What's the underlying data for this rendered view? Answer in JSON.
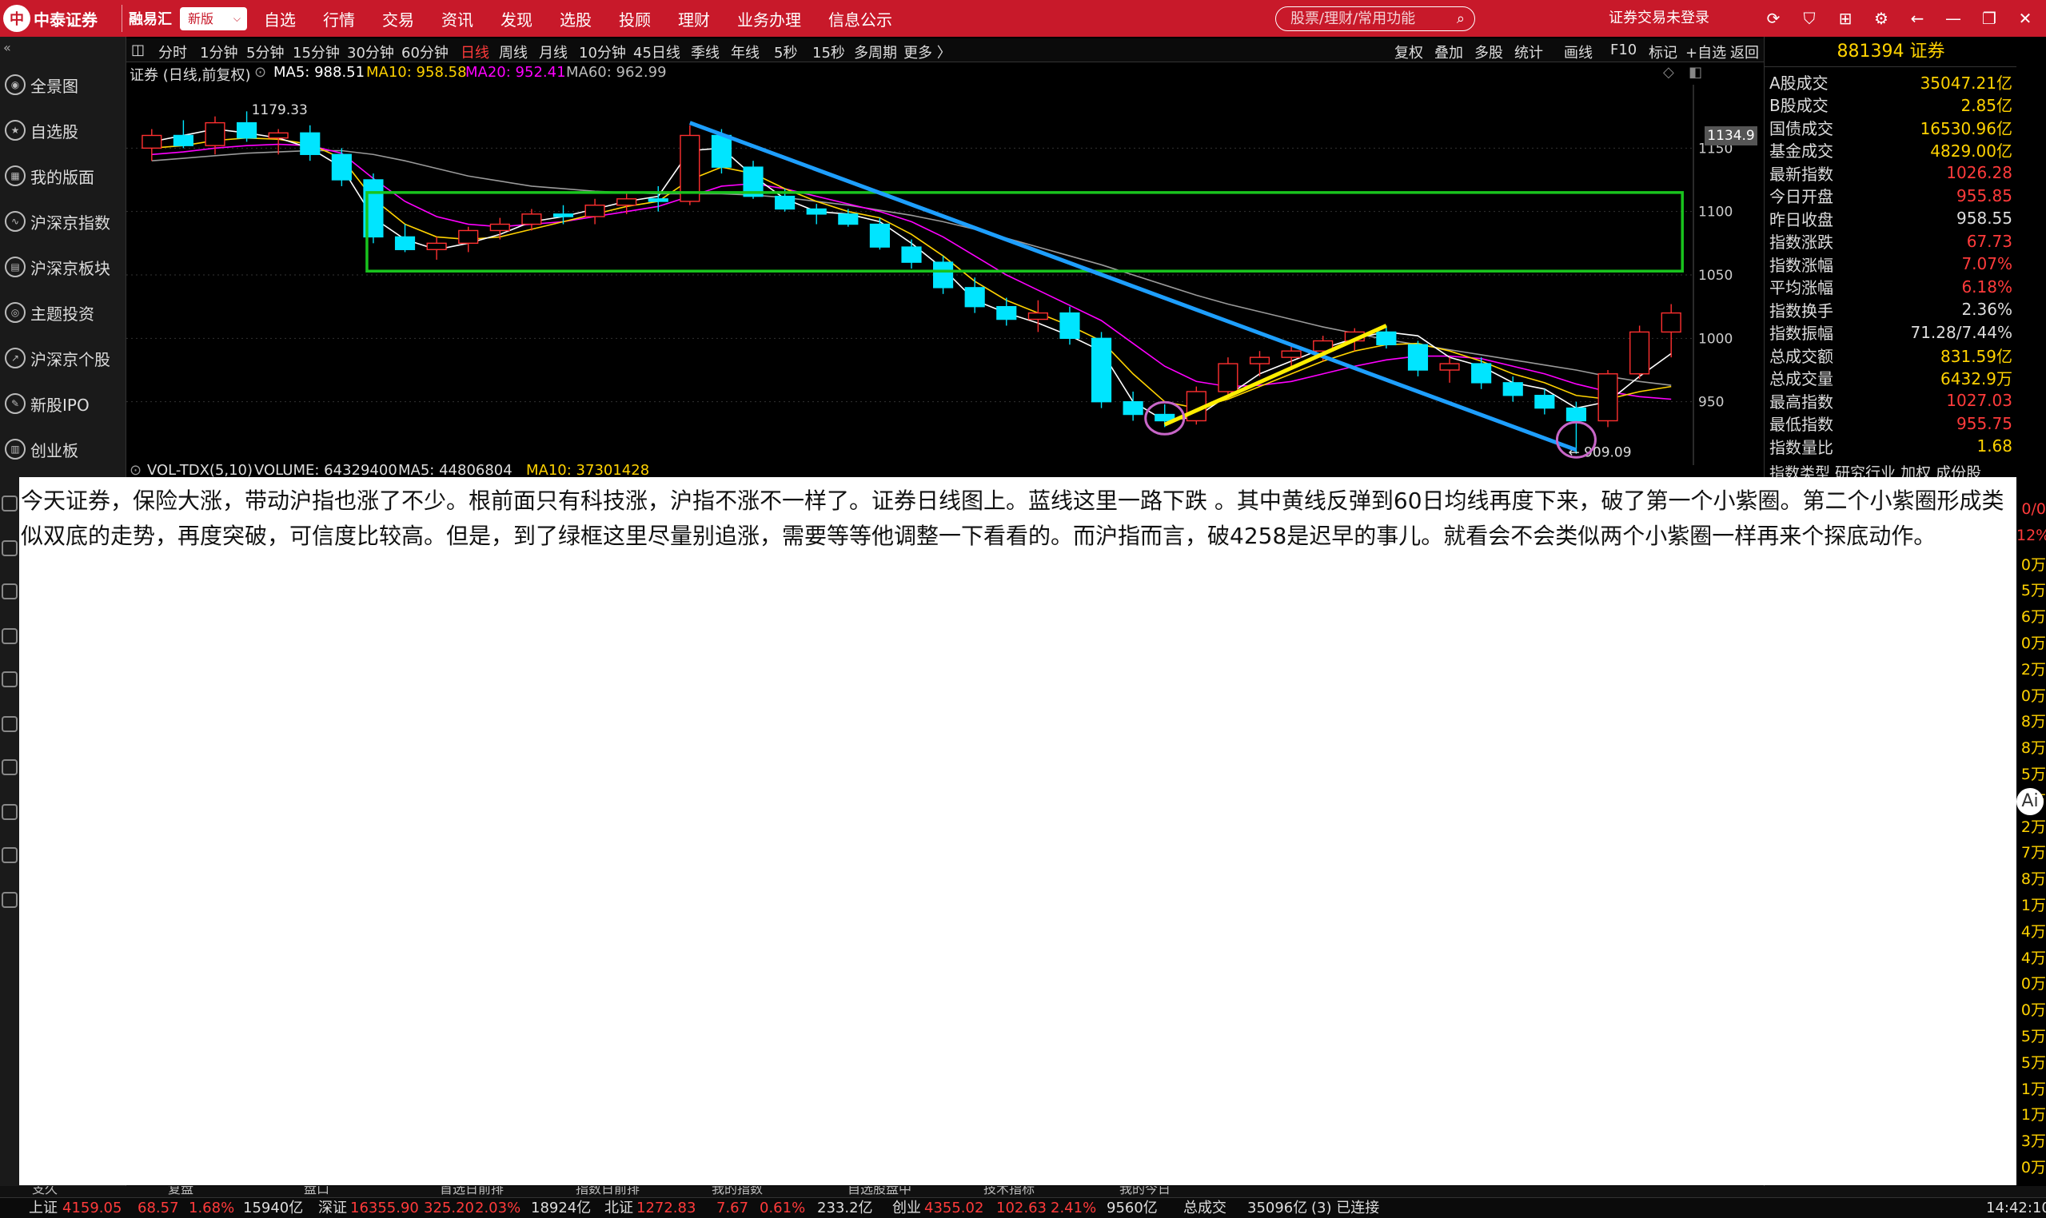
{
  "topbar": {
    "logo_char": "中",
    "brand": "中泰证券",
    "brand2": "融易汇",
    "version": "新版",
    "nav": [
      "自选",
      "行情",
      "交易",
      "资讯",
      "发现",
      "选股",
      "投顾",
      "理财",
      "业务办理",
      "信息公示"
    ],
    "search_placeholder": "股票/理财/常用功能",
    "login": "证券交易未登录"
  },
  "sidebar": {
    "items": [
      "全景图",
      "自选股",
      "我的版面",
      "沪深京指数",
      "沪深京板块",
      "主题投资",
      "沪深京个股",
      "新股IPO",
      "创业板"
    ]
  },
  "chart_toolbar": {
    "periods": [
      "分时",
      "1分钟",
      "5分钟",
      "15分钟",
      "30分钟",
      "60分钟",
      "日线",
      "周线",
      "月线",
      "10分钟",
      "45日线",
      "季线",
      "年线",
      "5秒",
      "15秒",
      "多周期",
      "更多 〉"
    ],
    "active_period": "日线",
    "tools": [
      "复权",
      "叠加",
      "多股",
      "统计",
      "画线",
      "F10",
      "标记",
      "+自选",
      "返回"
    ]
  },
  "chart_header": {
    "name": "证券 (日线,前复权)",
    "ma5": "MA5: 988.51",
    "ma10": "MA10: 958.58",
    "ma20": "MA20: 952.41",
    "ma60": "MA60: 962.99"
  },
  "volume_header": {
    "name": "VOL-TDX(5,10)",
    "volume": "VOLUME: 64329400",
    "ma5": "MA5: 44806804",
    "ma10": "MA10: 37301428"
  },
  "chart_data": {
    "type": "candlestick",
    "title": "证券 (日线,前复权)",
    "y_ticks": [
      1150,
      1100,
      1050,
      1000,
      950.0
    ],
    "ylim": [
      900,
      1200
    ],
    "high_label": "1179.33",
    "low_label": "909.09",
    "price_tag": "1134.9",
    "colors": {
      "up": "#ff3030",
      "down": "#00e5ff",
      "ma5": "#ffffff",
      "ma10": "#ffd200",
      "ma20": "#ff00ff",
      "ma60": "#9a9a9a",
      "trend_down": "#1e9fff",
      "trend_up": "#ffee00",
      "box": "#19c31e",
      "circle": "#c866c8"
    },
    "ma5": [
      1155,
      1160,
      1165,
      1162,
      1158,
      1150,
      1135,
      1095,
      1078,
      1070,
      1075,
      1082,
      1092,
      1096,
      1102,
      1108,
      1112,
      1148,
      1150,
      1128,
      1110,
      1100,
      1098,
      1092,
      1075,
      1055,
      1030,
      1020,
      1012,
      1002,
      990,
      950,
      935,
      938,
      955,
      972,
      982,
      992,
      1000,
      1005,
      1002,
      985,
      978,
      965,
      960,
      945,
      950,
      970,
      988
    ],
    "ma10": [
      1150,
      1152,
      1156,
      1158,
      1157,
      1153,
      1142,
      1110,
      1090,
      1080,
      1078,
      1080,
      1086,
      1092,
      1098,
      1104,
      1108,
      1125,
      1135,
      1130,
      1118,
      1108,
      1100,
      1095,
      1082,
      1065,
      1045,
      1030,
      1020,
      1010,
      998,
      972,
      950,
      945,
      952,
      962,
      972,
      982,
      990,
      995,
      996,
      990,
      982,
      972,
      965,
      955,
      952,
      958,
      962
    ],
    "ma20": [
      1145,
      1147,
      1150,
      1152,
      1153,
      1152,
      1146,
      1126,
      1108,
      1096,
      1090,
      1088,
      1090,
      1092,
      1096,
      1100,
      1104,
      1112,
      1120,
      1122,
      1118,
      1112,
      1106,
      1100,
      1092,
      1080,
      1065,
      1050,
      1038,
      1026,
      1014,
      996,
      978,
      966,
      962,
      963,
      966,
      972,
      978,
      983,
      986,
      986,
      984,
      978,
      972,
      964,
      958,
      954,
      952
    ],
    "ma60": [
      1140,
      1142,
      1144,
      1146,
      1147,
      1148,
      1148,
      1145,
      1140,
      1134,
      1128,
      1124,
      1120,
      1118,
      1116,
      1115,
      1114,
      1114,
      1114,
      1113,
      1111,
      1108,
      1105,
      1101,
      1097,
      1092,
      1086,
      1079,
      1072,
      1065,
      1058,
      1050,
      1042,
      1034,
      1027,
      1021,
      1015,
      1009,
      1004,
      999,
      995,
      991,
      987,
      983,
      979,
      975,
      970,
      966,
      963
    ],
    "ohlc": [
      [
        1150,
        1165,
        1140,
        1160
      ],
      [
        1160,
        1172,
        1150,
        1152
      ],
      [
        1152,
        1175,
        1145,
        1170
      ],
      [
        1170,
        1179,
        1155,
        1158
      ],
      [
        1158,
        1165,
        1145,
        1162
      ],
      [
        1162,
        1168,
        1140,
        1145
      ],
      [
        1145,
        1150,
        1120,
        1125
      ],
      [
        1125,
        1130,
        1075,
        1080
      ],
      [
        1080,
        1090,
        1068,
        1070
      ],
      [
        1070,
        1080,
        1062,
        1075
      ],
      [
        1075,
        1088,
        1068,
        1085
      ],
      [
        1085,
        1095,
        1078,
        1090
      ],
      [
        1090,
        1102,
        1085,
        1098
      ],
      [
        1098,
        1105,
        1090,
        1096
      ],
      [
        1096,
        1110,
        1090,
        1105
      ],
      [
        1105,
        1115,
        1098,
        1110
      ],
      [
        1110,
        1120,
        1100,
        1108
      ],
      [
        1108,
        1168,
        1105,
        1160
      ],
      [
        1160,
        1165,
        1130,
        1135
      ],
      [
        1135,
        1140,
        1110,
        1112
      ],
      [
        1112,
        1118,
        1100,
        1102
      ],
      [
        1102,
        1106,
        1090,
        1098
      ],
      [
        1098,
        1102,
        1088,
        1090
      ],
      [
        1090,
        1095,
        1070,
        1072
      ],
      [
        1072,
        1078,
        1055,
        1060
      ],
      [
        1060,
        1065,
        1035,
        1040
      ],
      [
        1040,
        1048,
        1020,
        1025
      ],
      [
        1025,
        1032,
        1010,
        1015
      ],
      [
        1015,
        1030,
        1005,
        1020
      ],
      [
        1020,
        1025,
        995,
        1000
      ],
      [
        1000,
        1005,
        945,
        950
      ],
      [
        950,
        958,
        935,
        940
      ],
      [
        940,
        948,
        930,
        935
      ],
      [
        935,
        962,
        932,
        958
      ],
      [
        958,
        985,
        955,
        980
      ],
      [
        980,
        990,
        970,
        985
      ],
      [
        985,
        995,
        978,
        990
      ],
      [
        990,
        1002,
        982,
        998
      ],
      [
        998,
        1008,
        990,
        1005
      ],
      [
        1005,
        1010,
        992,
        995
      ],
      [
        995,
        998,
        970,
        975
      ],
      [
        975,
        985,
        965,
        980
      ],
      [
        980,
        985,
        960,
        965
      ],
      [
        965,
        970,
        950,
        955
      ],
      [
        955,
        960,
        940,
        945
      ],
      [
        945,
        950,
        909,
        935
      ],
      [
        935,
        975,
        930,
        972
      ],
      [
        972,
        1010,
        968,
        1005
      ],
      [
        1005,
        1027,
        985,
        1020
      ]
    ]
  },
  "right_panel": {
    "title": "881394 证券",
    "rows": [
      {
        "label": "A股成交",
        "value": "35047.21亿",
        "color": "yellow"
      },
      {
        "label": "B股成交",
        "value": "2.85亿",
        "color": "yellow"
      },
      {
        "label": "国债成交",
        "value": "16530.96亿",
        "color": "yellow"
      },
      {
        "label": "基金成交",
        "value": "4829.00亿",
        "color": "yellow"
      },
      {
        "label": "最新指数",
        "value": "1026.28",
        "color": "red"
      },
      {
        "label": "今日开盘",
        "value": "955.85",
        "color": "red"
      },
      {
        "label": "昨日收盘",
        "value": "958.55",
        "color": "white"
      },
      {
        "label": "指数涨跌",
        "value": "67.73",
        "color": "red"
      },
      {
        "label": "指数涨幅",
        "value": "7.07%",
        "color": "red"
      },
      {
        "label": "平均涨幅",
        "value": "6.18%",
        "color": "red"
      },
      {
        "label": "指数换手",
        "value": "2.36%",
        "color": "white"
      },
      {
        "label": "指数振幅",
        "value": "71.28/7.44%",
        "color": "white"
      },
      {
        "label": "总成交额",
        "value": "831.59亿",
        "color": "yellow"
      },
      {
        "label": "总成交量",
        "value": "6432.9万",
        "color": "yellow"
      },
      {
        "label": "最高指数",
        "value": "1027.03",
        "color": "red"
      },
      {
        "label": "最低指数",
        "value": "955.75",
        "color": "red"
      },
      {
        "label": "指数量比",
        "value": "1.68",
        "color": "yellow"
      }
    ],
    "partial": "指数类型   研究行业 加权 成份股"
  },
  "right_strip": [
    "0/0",
    "12%",
    "0万",
    "5万",
    "6万",
    "0万",
    "2万",
    "0万",
    "8万",
    "8万",
    "5万",
    "2万",
    "2万",
    "7万",
    "8万",
    "1万",
    "4万",
    "4万",
    "0万",
    "0万",
    "5万",
    "5万",
    "1万",
    "1万",
    "3万",
    "0万",
    "2万",
    "0万"
  ],
  "note": {
    "text": "今天证券，保险大涨，带动沪指也涨了不少。根前面只有科技涨，沪指不涨不一样了。证券日线图上。蓝线这里一路下跌 。其中黄线反弹到60日均线再度下来，破了第一个小紫圈。第二个小紫圈形成类似双底的走势，再度突破，可信度比较高。但是，到了绿框这里尽量别追涨，需要等等他调整一下看看的。而沪指而言，破4258是迟早的事儿。就看会不会类似两个小紫圈一样再来个探底动作。"
  },
  "statusbar": {
    "sh_label": "上证",
    "sh_val": "4159.05",
    "sh_chg": "68.57",
    "sh_pct": "1.68%",
    "sh_amt": "15940亿",
    "sz_label": "深证",
    "sz_val": "16355.90",
    "sz_chg": "325.20",
    "sz_pct": "2.03%",
    "sz_amt": "18924亿",
    "bz_label": "北证",
    "bz_val": "1272.83",
    "bz_chg": "7.67",
    "bz_pct": "0.61%",
    "bz_amt": "233.2亿",
    "cy_label": "创业",
    "cy_val": "4355.02",
    "cy_chg": "102.63",
    "cy_pct": "2.41%",
    "cy_amt": "9560亿",
    "total_label": "总成交",
    "total_amt": "35096亿",
    "conn": "(3) 已连接",
    "time": "14:42:10"
  }
}
